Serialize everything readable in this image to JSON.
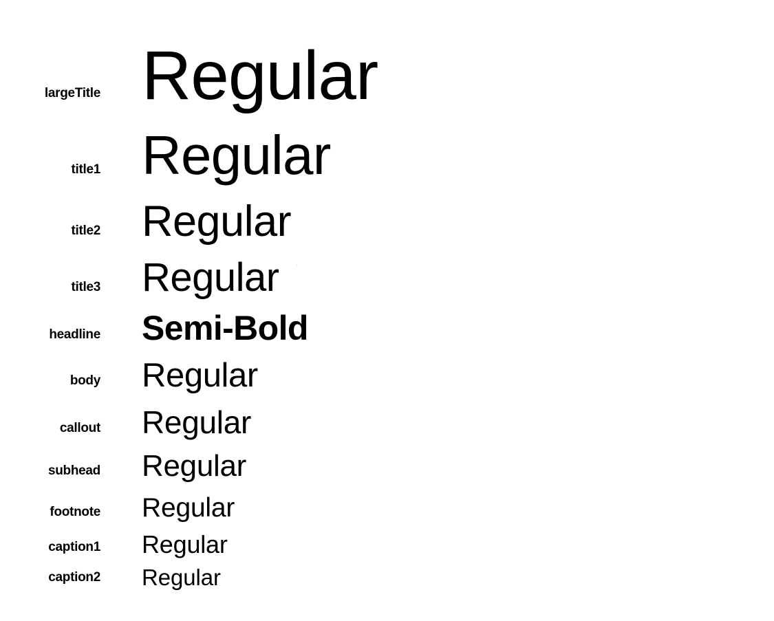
{
  "rows": [
    {
      "style_name": "largeTitle",
      "sample_text": "Regular"
    },
    {
      "style_name": "title1",
      "sample_text": "Regular"
    },
    {
      "style_name": "title2",
      "sample_text": "Regular"
    },
    {
      "style_name": "title3",
      "sample_text": "Regular"
    },
    {
      "style_name": "headline",
      "sample_text": "Semi-Bold"
    },
    {
      "style_name": "body",
      "sample_text": "Regular"
    },
    {
      "style_name": "callout",
      "sample_text": "Regular"
    },
    {
      "style_name": "subhead",
      "sample_text": "Regular"
    },
    {
      "style_name": "footnote",
      "sample_text": "Regular"
    },
    {
      "style_name": "caption1",
      "sample_text": "Regular"
    },
    {
      "style_name": "caption2",
      "sample_text": "Regular"
    }
  ],
  "colors": {
    "background": "#ffffff",
    "text": "#000000"
  }
}
